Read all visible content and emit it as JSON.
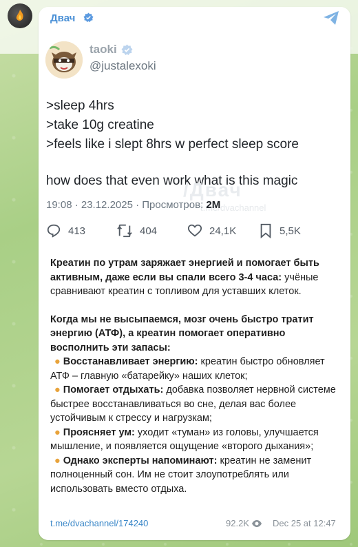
{
  "channel": {
    "name": "Двач"
  },
  "tweet": {
    "display_name": "taoki",
    "handle": "@justalexoki",
    "lines": [
      ">sleep 4hrs",
      ">take 10g creatine",
      ">feels like i slept 8hrs w perfect sleep score"
    ],
    "line2": "how does that even work what is this magic",
    "meta_time": "19:08 · 23.12.2025 · Просмотров: ",
    "meta_views": "2M",
    "watermark": "/Двач",
    "watermark_sub": "t.me/dvachannel",
    "actions": {
      "replies": "413",
      "retweets": "404",
      "likes": "24,1K",
      "bookmarks": "5,5K"
    }
  },
  "caption": {
    "intro_bold": "Креатин по утрам заряжает энергией и помогает быть активным, даже если вы спали всего 3-4 часа:",
    "intro_rest": " учёные сравнивают креатин с топливом для уставших клеток.",
    "para2_bold": "Когда мы не высыпаемся, мозг очень быстро тратит энергию (АТФ), а креатин помогает оперативно восполнить эти запасы:",
    "bullets": [
      {
        "bold": "Восстанавливает энергию:",
        "text": " креатин быстро обновляет АТФ – главную «батарейку» наших клеток;"
      },
      {
        "bold": "Помогает отдыхать:",
        "text": " добавка позволяет нервной системе быстрее восстанавливаться во сне, делая вас более устойчивым к стрессу и нагрузкам;"
      },
      {
        "bold": "Проясняет ум:",
        "text": " уходит «туман» из головы, улучшается мышление, и появляется ощущение «второго дыхания»;"
      },
      {
        "bold": "Однако эксперты напоминают:",
        "text": " креатин не заменит полноценный сон. Им не стоит злоупотреблять или использовать вместо отдыха."
      }
    ]
  },
  "footer": {
    "link": "t.me/dvachannel/174240",
    "views": "92.2K",
    "date": "Dec 25 at 12:47"
  },
  "colors": {
    "link": "#3a87c8",
    "bullet": "#e8a33b",
    "channel_name": "#4a90d6"
  }
}
